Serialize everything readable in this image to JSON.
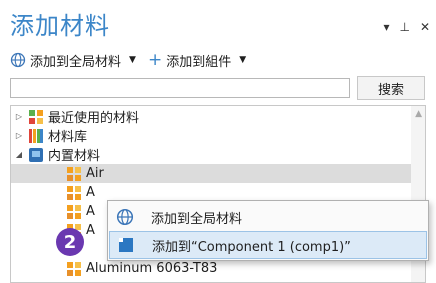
{
  "window": {
    "title": "添加材料",
    "controls": {
      "dropdown": "▾",
      "pin": "⊥",
      "close": "✕"
    }
  },
  "toolbar": {
    "add_global": "添加到全局材料",
    "add_component": "添加到組件",
    "dropdown_arrow": "▼",
    "plus": "+"
  },
  "search": {
    "value": "",
    "placeholder": "",
    "button": "搜索"
  },
  "tree": {
    "items": [
      {
        "label": "最近使用的材料",
        "expander": "▷",
        "icon": "recent-materials-icon"
      },
      {
        "label": "材料库",
        "expander": "▷",
        "icon": "material-library-icon"
      },
      {
        "label": "内置材料",
        "expander": "◢",
        "icon": "builtin-materials-icon"
      },
      {
        "label": "Air",
        "icon": "material-icon",
        "selected": true
      },
      {
        "label": "A",
        "icon": "material-icon"
      },
      {
        "label": "A",
        "icon": "material-icon"
      },
      {
        "label": "A",
        "icon": "material-icon"
      },
      {
        "label": "Aluminum 6063-T83",
        "icon": "material-icon"
      }
    ]
  },
  "context_menu": {
    "items": [
      {
        "label": "添加到全局材料",
        "icon": "globe-icon"
      },
      {
        "label": "添加到“Component 1 (comp1)”",
        "icon": "component-icon",
        "highlighted": true
      }
    ]
  },
  "step_badge": "2",
  "colors": {
    "title": "#3c86c8",
    "badge": "#6a38b0",
    "highlight": "#dceaf7"
  }
}
